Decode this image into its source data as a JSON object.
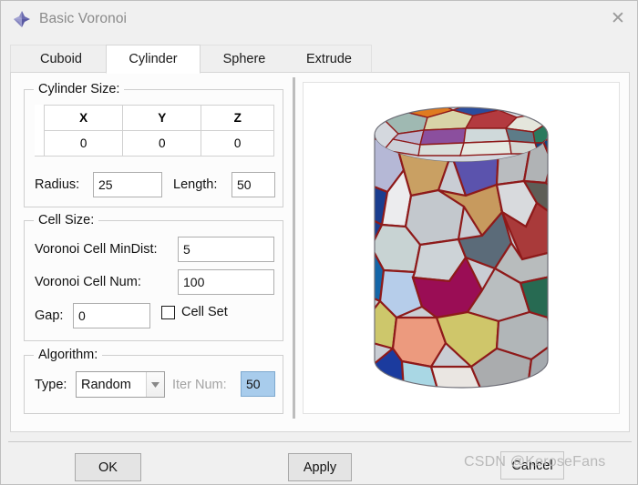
{
  "window": {
    "title": "Basic Voronoi",
    "icon": "octahedron-icon",
    "close_label": "✕"
  },
  "tabs": [
    {
      "label": "Cuboid",
      "active": false
    },
    {
      "label": "Cylinder",
      "active": true
    },
    {
      "label": "Sphere",
      "active": false
    },
    {
      "label": "Extrude",
      "active": false
    }
  ],
  "cylinder_size": {
    "legend": "Cylinder Size:",
    "columns": [
      "X",
      "Y",
      "Z"
    ],
    "values": [
      "0",
      "0",
      "0"
    ],
    "radius_label": "Radius:",
    "radius_value": "25",
    "length_label": "Length:",
    "length_value": "50"
  },
  "cell_size": {
    "legend": "Cell Size:",
    "mindist_label": "Voronoi Cell MinDist:",
    "mindist_value": "5",
    "num_label": "Voronoi Cell Num:",
    "num_value": "100",
    "gap_label": "Gap:",
    "gap_value": "0",
    "cellset_label": "Cell Set",
    "cellset_checked": false
  },
  "algorithm": {
    "legend": "Algorithm:",
    "type_label": "Type:",
    "type_value": "Random",
    "type_options": [
      "Random"
    ],
    "iternum_label": "Iter Num:",
    "iternum_value": "50",
    "iternum_disabled": true
  },
  "viewport": {
    "name": "voronoi-3d-preview",
    "shape": "cylinder",
    "background": "#ffffff",
    "cell_edge_color": "#8e1a1a"
  },
  "footer": {
    "ok_label": "OK",
    "apply_label": "Apply",
    "cancel_label": "Cancel"
  },
  "watermark": {
    "text": "CSDN @KeroseFans"
  }
}
